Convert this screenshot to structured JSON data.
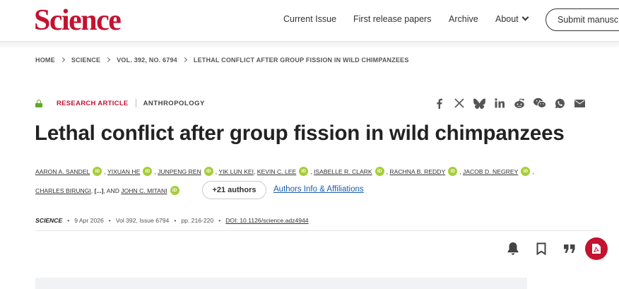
{
  "header": {
    "logo": "Science",
    "nav": [
      "Current Issue",
      "First release papers",
      "Archive",
      "About"
    ],
    "submit": "Submit manuscript"
  },
  "breadcrumb": [
    "HOME",
    "SCIENCE",
    "VOL. 392, NO. 6794",
    "LETHAL CONFLICT AFTER GROUP FISSION IN WILD CHIMPANZEES"
  ],
  "article": {
    "type": "RESEARCH ARTICLE",
    "subject": "ANTHROPOLOGY",
    "title": "Lethal conflict after group fission in wild chimpanzees",
    "authors_line1": [
      "AARON A. SANDEL",
      "YIXUAN HE",
      "JUNPENG REN",
      "YIK LUN KEI",
      "KEVIN C. LEE",
      "ISABELLE R. CLARK",
      "RACHNA B. REDDY",
      "JACOB D. NEGREY"
    ],
    "authors_line2_a": "CHARLES BIRUNGI",
    "ellipsis": "[...]",
    "and": ", AND",
    "authors_line2_b": "JOHN C. MITANI",
    "more_authors": "+21 authors",
    "affiliations": "Authors Info & Affiliations",
    "orcid_label": "iD"
  },
  "publication": {
    "journal": "SCIENCE",
    "date": "9 Apr 2026",
    "issue": "Vol 392, Issue 6794",
    "pages": "pp. 216-220",
    "doi": "DOI: 10.1126/science.adz4944"
  },
  "share_icons": [
    "facebook-icon",
    "x-icon",
    "bluesky-icon",
    "linkedin-icon",
    "reddit-icon",
    "wechat-icon",
    "whatsapp-icon",
    "email-icon"
  ],
  "tools": [
    "bell-icon",
    "bookmark-icon",
    "quote-icon",
    "pdf-icon"
  ],
  "colors": {
    "brand": "#c41230",
    "orcid": "#a6ce39",
    "link": "#1a5dab",
    "lock": "#5fa92a"
  }
}
